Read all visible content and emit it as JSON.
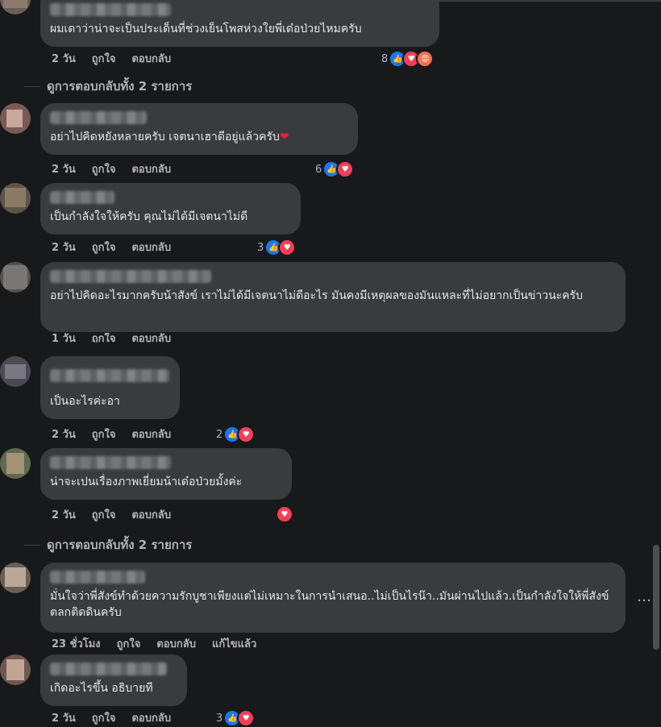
{
  "labels": {
    "like": "ถูกใจ",
    "reply": "ตอบกลับ",
    "edited": "แก้ไขแล้ว"
  },
  "view_replies": [
    "ดูการตอบกลับทั้ง 2 รายการ",
    "ดูการตอบกลับทั้ง 2 รายการ"
  ],
  "more_icon": "…",
  "comments": [
    {
      "text": "ผมเดาว่าน่าจะเป็นประเด็นที่ช่วงเย็นโพสห่วงใยพี่เด๋อป่วยไหมครับ",
      "time": "2 วัน",
      "reactions": "8",
      "reaction_icons": [
        "like-icon",
        "love-icon",
        "angry-icon"
      ]
    },
    {
      "text": "อย่าไปคิดหยังหลายครับ เจตนาเฮาดีอยู่แล้วครับ",
      "heart": "❤",
      "time": "2 วัน",
      "reactions": "6",
      "reaction_icons": [
        "like-icon",
        "love-icon"
      ]
    },
    {
      "text": "เป็นกำลังใจให้ครับ คุณไม่ได้มีเจตนาไม่ดี",
      "time": "2 วัน",
      "reactions": "3",
      "reaction_icons": [
        "like-icon",
        "love-icon"
      ]
    },
    {
      "text": "อย่าไปคิดอะไรมากครับน้าสังข์ เราไม่ได้มีเจตนาไม่ดีอะไร มันคงมีเหตุผลของมันแหละที่ไม่อยากเป็นข่าวนะครับ",
      "time": "1 วัน"
    },
    {
      "text": "เป็นอะไรค่ะอา",
      "time": "2 วัน",
      "reactions": "2",
      "reaction_icons": [
        "like-icon",
        "love-icon"
      ]
    },
    {
      "text": "น่าจะเปนเรื่องภาพเยี่ยมน้าเด๋อป่วยมั้งค่ะ",
      "time": "2 วัน",
      "reactions": "",
      "reaction_icons": [
        "love-icon"
      ]
    },
    {
      "text": "มั่นใจว่าพี่สังข์ทำด้วยความรักบูชาเพียงแต่ไม่เหมาะในการนำเสนอ..ไม่เป็นไรน๊า..มันผ่านไปแล้ว.เป็นกำลังใจให้พี่สังข์ตลกติดดินครับ",
      "time": "23 ชั่วโมง"
    },
    {
      "text": "เกิดอะไรขึ้น อธิบายที",
      "time": "2 วัน",
      "reactions": "3",
      "reaction_icons": [
        "like-icon",
        "love-icon"
      ]
    }
  ]
}
